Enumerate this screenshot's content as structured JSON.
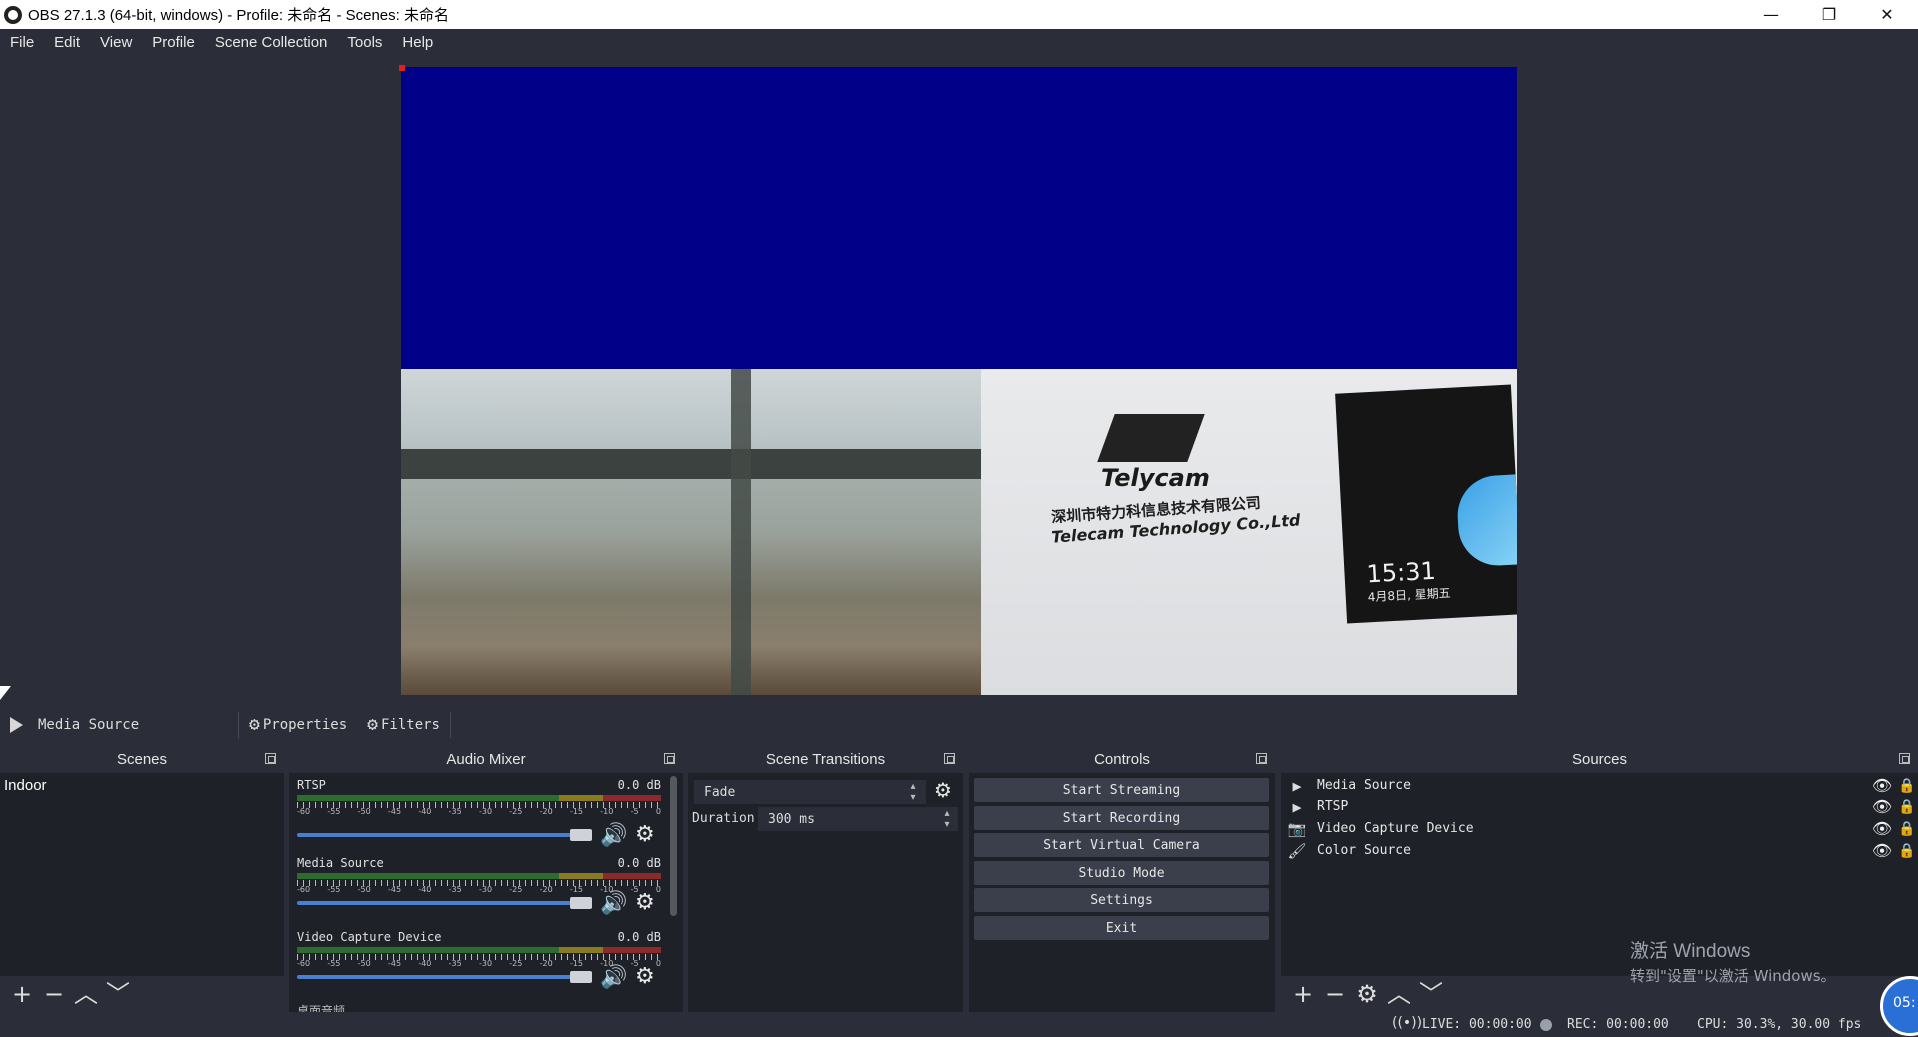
{
  "window": {
    "title": "OBS 27.1.3 (64-bit, windows) - Profile: 未命名 - Scenes: 未命名",
    "controls": {
      "minimize": "—",
      "restore": "❐",
      "close": "✕"
    }
  },
  "menu": [
    "File",
    "Edit",
    "View",
    "Profile",
    "Scene Collection",
    "Tools",
    "Help"
  ],
  "preview": {
    "camera_brand": "Telycam",
    "camera_tagline_cn": "深圳市特力科信息技术有限公司",
    "camera_tagline_en": "Telecam Technology Co.,Ltd",
    "tv_clock": "15:31",
    "tv_date": "4月8日, 星期五",
    "colors": {
      "color_source": "#000088",
      "selection_handle": "#e02020"
    }
  },
  "source_toolbar": {
    "selected_source": "Media Source",
    "properties_label": "Properties",
    "filters_label": "Filters"
  },
  "scenes": {
    "header": "Scenes",
    "items": [
      "Indoor"
    ]
  },
  "mixer": {
    "header": "Audio Mixer",
    "scale": [
      "-60",
      "-55",
      "-50",
      "-45",
      "-40",
      "-35",
      "-30",
      "-25",
      "-20",
      "-15",
      "-10",
      "-5",
      "0"
    ],
    "channels": [
      {
        "name": "RTSP",
        "db": "0.0 dB",
        "volume": 1.0
      },
      {
        "name": "Media Source",
        "db": "0.0 dB",
        "volume": 1.0
      },
      {
        "name": "Video Capture Device",
        "db": "0.0 dB",
        "volume": 1.0
      }
    ],
    "cut_off_channel": "桌面音频"
  },
  "transitions": {
    "header": "Scene Transitions",
    "selected": "Fade",
    "duration_label": "Duration",
    "duration_value": "300 ms"
  },
  "controls": {
    "header": "Controls",
    "buttons": [
      "Start Streaming",
      "Start Recording",
      "Start Virtual Camera",
      "Studio Mode",
      "Settings",
      "Exit"
    ]
  },
  "sources": {
    "header": "Sources",
    "items": [
      {
        "name": "Media Source",
        "icon": "play-icon"
      },
      {
        "name": "RTSP",
        "icon": "play-icon"
      },
      {
        "name": "Video Capture Device",
        "icon": "camera-icon"
      },
      {
        "name": "Color Source",
        "icon": "brush-icon"
      }
    ]
  },
  "watermark": {
    "line1": "激活 Windows",
    "line2": "转到\"设置\"以激活 Windows。"
  },
  "status": {
    "live": "LIVE: 00:00:00",
    "rec": "REC: 00:00:00",
    "cpu": "CPU: 30.3%, 30.00 fps",
    "clock_bubble": "05:"
  }
}
